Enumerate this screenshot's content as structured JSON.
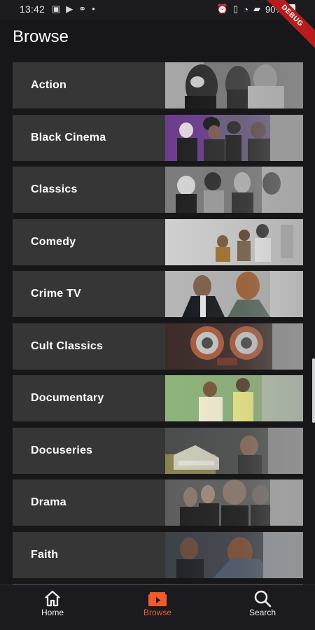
{
  "status_bar": {
    "time": "13:42",
    "battery": "90%",
    "debug_label": "DEBUG",
    "left_icons": [
      "image-icon",
      "play-store-icon",
      "link-icon",
      "dot-icon"
    ],
    "right_icons": [
      "alarm-icon",
      "vibrate-icon",
      "wifi-icon",
      "signal-icon",
      "battery-icon"
    ]
  },
  "page": {
    "title": "Browse"
  },
  "categories": [
    {
      "label": "Action"
    },
    {
      "label": "Black Cinema"
    },
    {
      "label": "Classics"
    },
    {
      "label": "Comedy"
    },
    {
      "label": "Crime TV"
    },
    {
      "label": "Cult Classics"
    },
    {
      "label": "Documentary"
    },
    {
      "label": "Docuseries"
    },
    {
      "label": "Drama"
    },
    {
      "label": "Faith"
    }
  ],
  "bottom_nav": {
    "items": [
      {
        "label": "Home",
        "icon": "home-icon"
      },
      {
        "label": "Browse",
        "icon": "browse-icon"
      },
      {
        "label": "Search",
        "icon": "search-icon"
      }
    ],
    "active_index": 1,
    "active_color": "#f05b2c",
    "inactive_color": "#f0f0f0"
  }
}
